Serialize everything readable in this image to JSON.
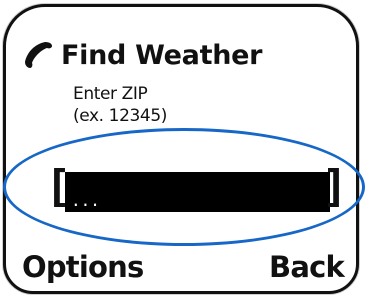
{
  "screen": {
    "title": "Find Weather",
    "title_icon": "phone-handset-icon",
    "prompt_line1": "Enter ZIP",
    "prompt_line2": "(ex. 12345)"
  },
  "zip_field": {
    "value": "",
    "placeholder": "...",
    "left_bracket": "[",
    "right_bracket": "]",
    "focus_color": "#1667c7"
  },
  "softkeys": {
    "left_label": "Options",
    "right_label": "Back"
  }
}
